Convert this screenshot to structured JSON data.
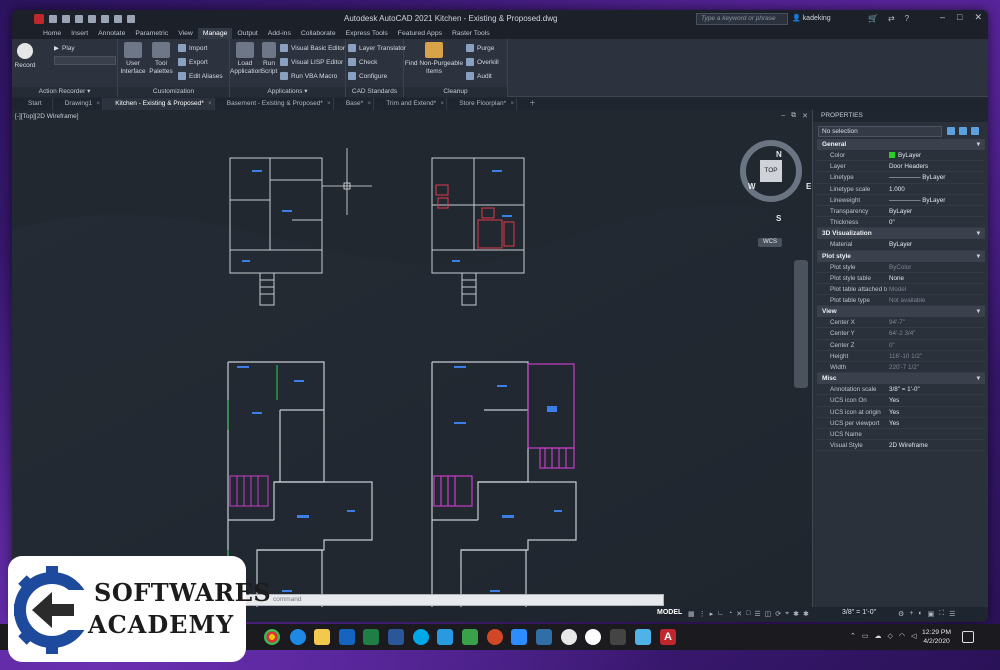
{
  "title": "Autodesk AutoCAD 2021   Kitchen - Existing & Proposed.dwg",
  "search_placeholder": "Type a keyword or phrase",
  "user": "kadeking",
  "ribbon_tabs": [
    "Home",
    "Insert",
    "Annotate",
    "Parametric",
    "View",
    "Manage",
    "Output",
    "Add-ins",
    "Collaborate",
    "Express Tools",
    "Featured Apps",
    "Raster Tools"
  ],
  "active_tab": "Manage",
  "ribbon": {
    "action_recorder": {
      "title": "Action Recorder",
      "record": "Record",
      "play": "Play"
    },
    "customization": {
      "title": "Customization",
      "user_interface": "User Interface",
      "tool_palettes": "Tool Palettes",
      "import": "Import",
      "export": "Export",
      "edit_aliases": "Edit Aliases"
    },
    "applications": {
      "title": "Applications",
      "load_application": "Load Application",
      "run_script": "Run Script",
      "vba_editor": "Visual Basic Editor",
      "lisp_editor": "Visual LISP Editor",
      "run_vba": "Run VBA Macro"
    },
    "cad_standards": {
      "title": "CAD Standards",
      "layer_translator": "Layer Translator",
      "check": "Check",
      "configure": "Configure"
    },
    "cleanup": {
      "title": "Cleanup",
      "find_nonpurgeable": "Find Non-Purgeable Items",
      "purge": "Purge",
      "overkill": "Overkill",
      "audit": "Audit"
    }
  },
  "file_tabs": [
    "Start",
    "Drawing1",
    "Kitchen - Existing & Proposed*",
    "Basement - Existing & Proposed*",
    "Base*",
    "Trim and Extend*",
    "Store Floorplan*"
  ],
  "active_file_tab": "Kitchen - Existing & Proposed*",
  "viewport_label": "[-][Top][2D Wireframe]",
  "viewcube": {
    "top": "TOP",
    "n": "N",
    "s": "S",
    "e": "E",
    "w": "W",
    "ucs": "WCS"
  },
  "properties": {
    "header": "PROPERTIES",
    "selection": "No selection",
    "sections": [
      {
        "name": "General",
        "rows": [
          {
            "k": "Color",
            "v": "ByLayer",
            "swatch": "#25d025"
          },
          {
            "k": "Layer",
            "v": "Door Headers"
          },
          {
            "k": "Linetype",
            "v": "————— ByLayer"
          },
          {
            "k": "Linetype scale",
            "v": "1.000"
          },
          {
            "k": "Lineweight",
            "v": "————— ByLayer"
          },
          {
            "k": "Transparency",
            "v": "ByLayer"
          },
          {
            "k": "Thickness",
            "v": "0\""
          }
        ]
      },
      {
        "name": "3D Visualization",
        "rows": [
          {
            "k": "Material",
            "v": "ByLayer"
          }
        ]
      },
      {
        "name": "Plot style",
        "rows": [
          {
            "k": "Plot style",
            "v": "ByColor",
            "dim": true
          },
          {
            "k": "Plot style table",
            "v": "None"
          },
          {
            "k": "Plot table attached to",
            "v": "Model",
            "dim": true
          },
          {
            "k": "Plot table type",
            "v": "Not available",
            "dim": true
          }
        ]
      },
      {
        "name": "View",
        "rows": [
          {
            "k": "Center X",
            "v": "94'-7\"",
            "dim": true
          },
          {
            "k": "Center Y",
            "v": "64'-2 3/4\"",
            "dim": true
          },
          {
            "k": "Center Z",
            "v": "0\"",
            "dim": true
          },
          {
            "k": "Height",
            "v": "116'-10 1/2\"",
            "dim": true
          },
          {
            "k": "Width",
            "v": "220'-7 1/2\"",
            "dim": true
          }
        ]
      },
      {
        "name": "Misc",
        "rows": [
          {
            "k": "Annotation scale",
            "v": "3/8\" = 1'-0\""
          },
          {
            "k": "UCS icon On",
            "v": "Yes"
          },
          {
            "k": "UCS icon at origin",
            "v": "Yes"
          },
          {
            "k": "UCS per viewport",
            "v": "Yes"
          },
          {
            "k": "UCS Name",
            "v": ""
          },
          {
            "k": "Visual Style",
            "v": "2D Wireframe"
          }
        ]
      }
    ]
  },
  "command_placeholder": "command",
  "status": {
    "model": "MODEL",
    "scale": "3/8\" = 1'-0\""
  },
  "clock": {
    "time": "12:29 PM",
    "date": "4/2/2020"
  },
  "logo": {
    "line1": "SOFTWARES",
    "line2": "ACADEMY"
  }
}
